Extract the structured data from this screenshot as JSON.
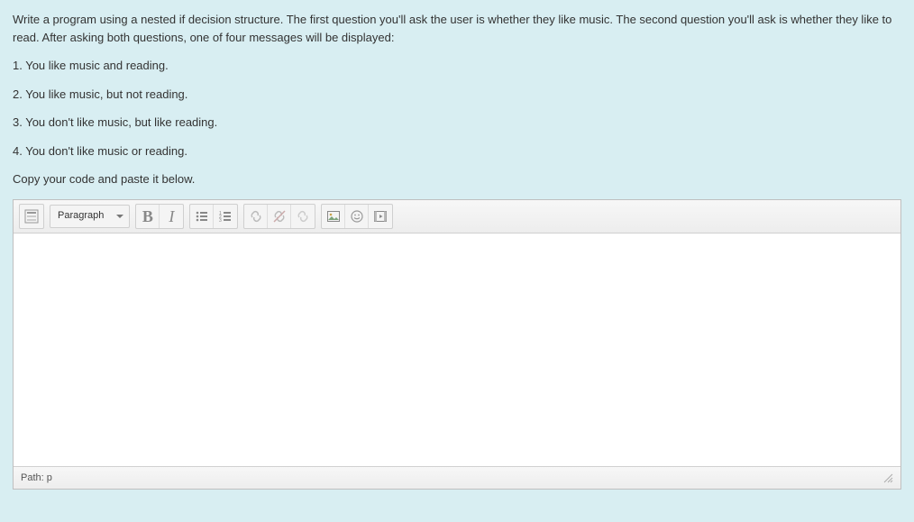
{
  "question": {
    "intro": "Write a program using a nested if decision structure.  The first question you'll ask the user is whether they like music.  The second question you'll ask is whether they like to read.  After asking both questions, one of four messages will be displayed:",
    "messages": [
      "1.  You like music and reading.",
      "2.  You like music, but not reading.",
      "3.  You don't like music, but like reading.",
      "4.  You don't like music or reading."
    ],
    "instruction": "Copy your code and paste it below."
  },
  "editor": {
    "format_dropdown": "Paragraph",
    "path_label": "Path: p",
    "content": "",
    "toolbar": {
      "toggle_toolbar": "toggle-toolbar",
      "format": "format-select",
      "bold": "B",
      "italic": "I",
      "bullets": "unordered-list",
      "numbers": "ordered-list",
      "link": "link",
      "unlink": "unlink",
      "anchor": "autolink",
      "image": "image",
      "emoji": "emoji",
      "media": "media"
    }
  }
}
